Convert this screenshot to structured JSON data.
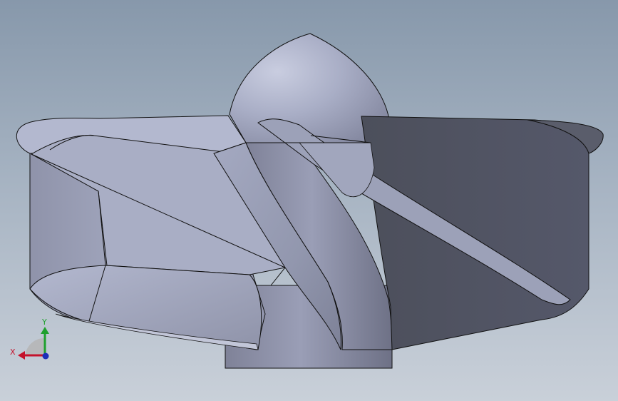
{
  "viewport": {
    "background_top": "#8798ab",
    "background_bottom": "#c9d0d9"
  },
  "model": {
    "name": "impeller",
    "surface_light": "#b3b8cf",
    "surface_mid": "#8c90a6",
    "surface_dark": "#4f525e",
    "edge_color": "#111111"
  },
  "triad": {
    "x_label": "X",
    "y_label": "Y",
    "x_color": "#c4122b",
    "y_color": "#1fa02d",
    "z_color": "#1b2fb8",
    "plane_color": "#b5b5b5"
  }
}
